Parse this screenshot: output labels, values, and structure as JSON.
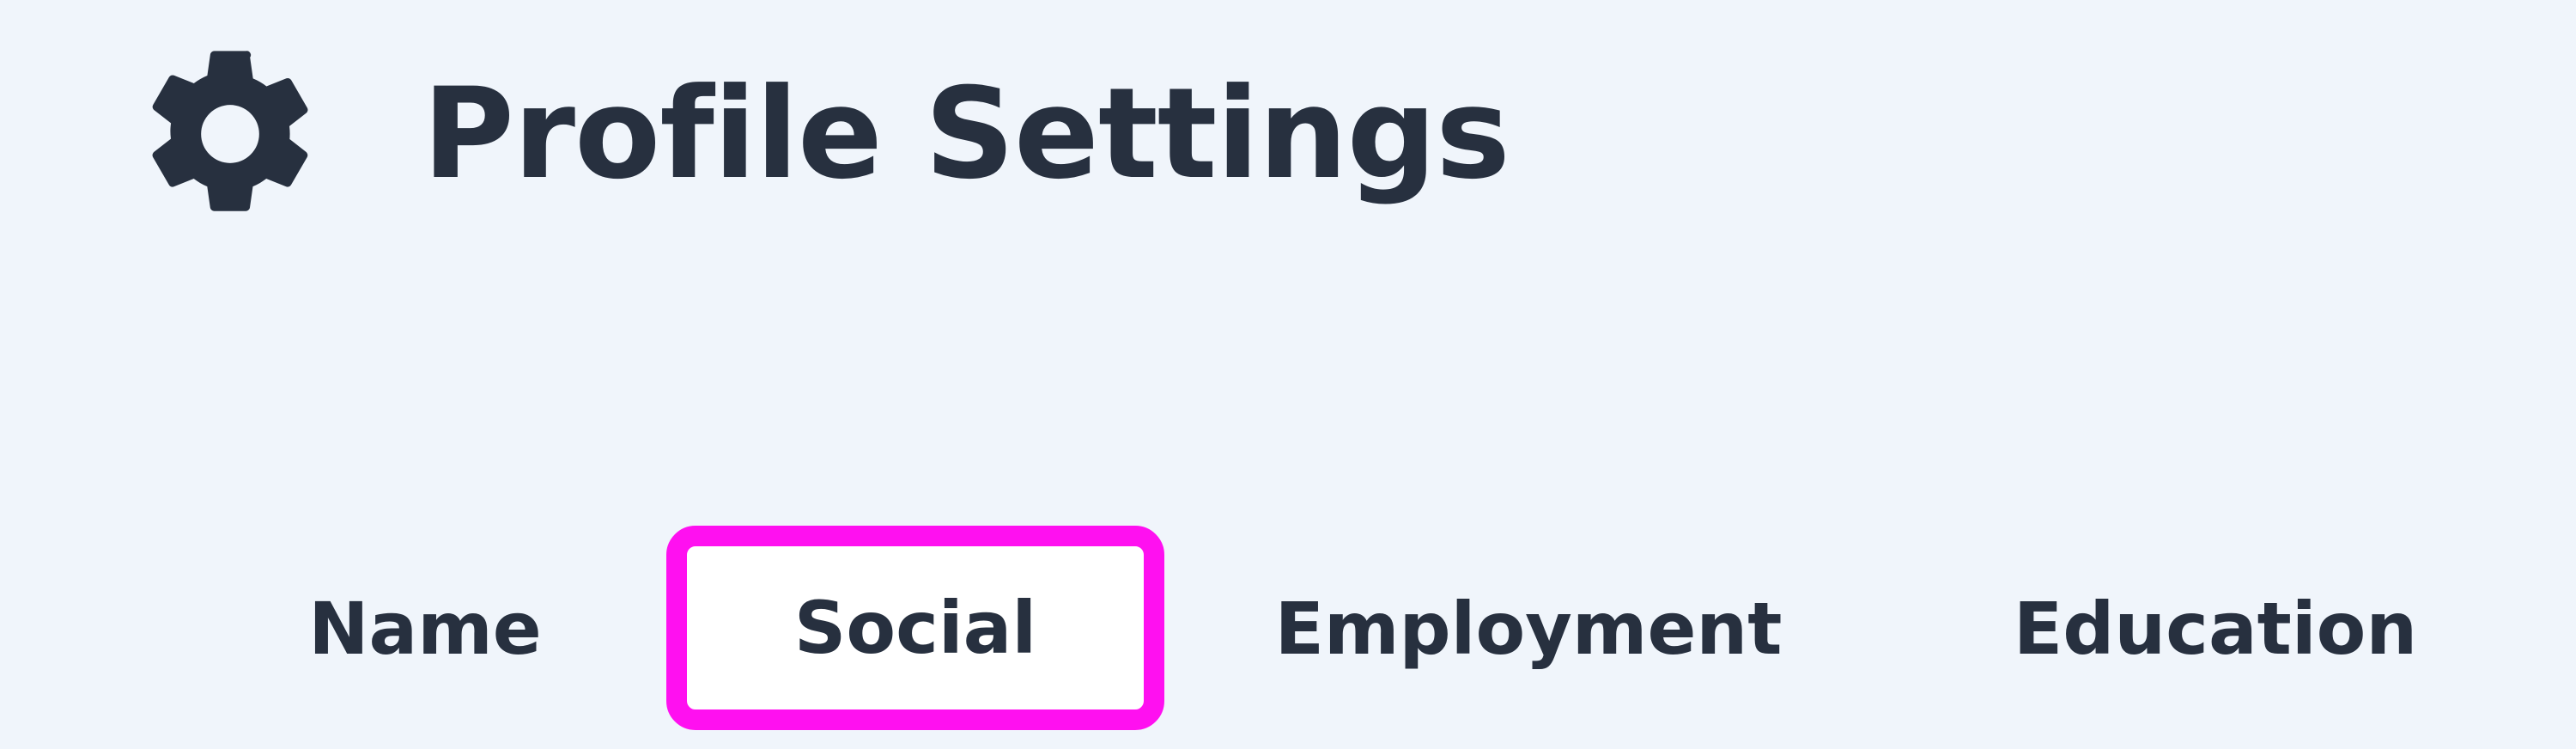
{
  "header": {
    "icon": "gear-icon",
    "title": "Profile Settings"
  },
  "tabs": [
    {
      "label": "Name",
      "selected": false
    },
    {
      "label": "Social",
      "selected": true
    },
    {
      "label": "Employment",
      "selected": false
    },
    {
      "label": "Education",
      "selected": false
    }
  ],
  "colors": {
    "background": "#f0f5fb",
    "text": "#27303f",
    "highlight_border": "#ff10f0",
    "selected_tab_background": "#ffffff"
  }
}
